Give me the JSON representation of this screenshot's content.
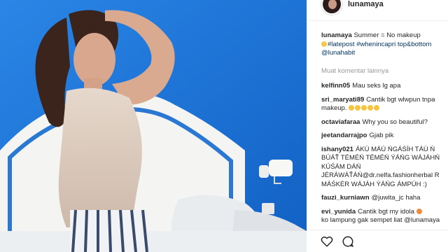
{
  "header": {
    "username": "lunamaya"
  },
  "caption": {
    "username": "lunamaya",
    "text": "Summer = No makeup",
    "hashtags": "#latepost #whenincapri top&bottom",
    "mention": "@lunahabit"
  },
  "more_comments_label": "Muat komentar lainnya",
  "comments": [
    {
      "user": "kelfinn05",
      "line1": "Mau seks lg apa",
      "line2": ""
    },
    {
      "user": "sri_maryati89",
      "line1": "Cantik bgt wlwpun tnpa",
      "line2": "makeup."
    },
    {
      "user": "octaviafaraa",
      "line1": "Why you so beautiful?",
      "line2": ""
    },
    {
      "user": "jeetandarrajpo",
      "line1": "Gjab pik",
      "line2": ""
    },
    {
      "user": "ishany021",
      "line1": "ÁKÚ MÁÚ ŃGÁŚÍH TÁÚ Ń",
      "line2": "BÚÁŤ TÉMÉŃ TÉMÉŃ ÝÁŃG WÁJÁHŃ",
      "line3": "KÚŚÁM DÁŃ",
      "line4": "JÉRÁWÁŤÁŃ@dr.nelfa.fashionherbal R",
      "line5": "MÁŚKÉR WÁJÁH ÝÁŃG ÁMPÚH :)"
    },
    {
      "user": "fauzi_kurniawn",
      "line1": "@juwita_jc haha",
      "line2": ""
    },
    {
      "user": "evi_yunida",
      "line1": "Cantik bgt my idola",
      "line2": "ko lampung gak sempet liat @lunamaya"
    }
  ],
  "icons": [
    "heart-icon",
    "comment-icon"
  ],
  "colors": {
    "wall_blue": "#1e73d8",
    "link": "#003569",
    "muted": "#999999"
  }
}
